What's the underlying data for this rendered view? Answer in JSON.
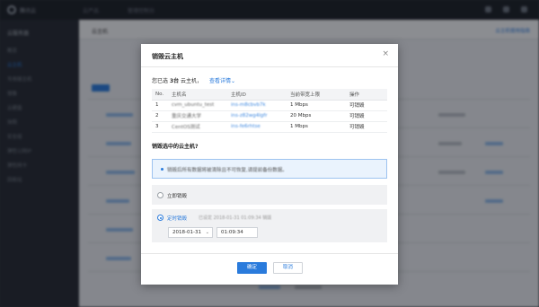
{
  "background": {
    "logo_text": "腾讯云",
    "top_nav": [
      "云产品",
      "管理控制台"
    ],
    "sidebar_title": "云服务器",
    "sidebar_items": [
      "概览",
      "云主机",
      "专用宿主机",
      "镜像",
      "云硬盘",
      "快照",
      "安全组",
      "弹性公网IP",
      "弹性网卡",
      "回收站"
    ],
    "main_title": "云主机",
    "main_link": "云主机使用指南"
  },
  "modal": {
    "title": "销毁云主机",
    "close_symbol": "×",
    "selection": {
      "prefix": "您已选",
      "count": "3台",
      "suffix": "云主机，",
      "details_link": "查看详情",
      "details_chevron": "⌄"
    },
    "table": {
      "headers": [
        "No.",
        "主机名",
        "主机ID",
        "当前带宽上限",
        "操作"
      ],
      "rows": [
        {
          "no": "1",
          "name": "cvm_ubuntu_test",
          "id": "ins-m8cbvb7k",
          "bandwidth": "1 Mbps",
          "action": "可销毁"
        },
        {
          "no": "2",
          "name": "重庆交通大学",
          "id": "ins-z82wg4lgfr",
          "bandwidth": "20 Mbps",
          "action": "可销毁"
        },
        {
          "no": "3",
          "name": "CentOS测试",
          "id": "ins-fe6rhtse",
          "bandwidth": "1 Mbps",
          "action": "可销毁"
        }
      ]
    },
    "question": "销毁选中的云主机?",
    "notice": "销毁后所有数据将被清除且不可恢复,请提前备份数据。",
    "options": {
      "immediate": "立即销毁",
      "scheduled": "定时销毁",
      "scheduled_hint": "已设定 2018-01-31 01:09:34 销毁",
      "date_value": "2018-01-31",
      "date_chevron": "⌄",
      "time_value": "01:09:34"
    },
    "buttons": {
      "ok": "确定",
      "cancel": "取消"
    }
  },
  "colors": {
    "accent": "#2a7bdc",
    "notice_bg": "#eaf3fd",
    "overlay": "#0a0e14"
  }
}
